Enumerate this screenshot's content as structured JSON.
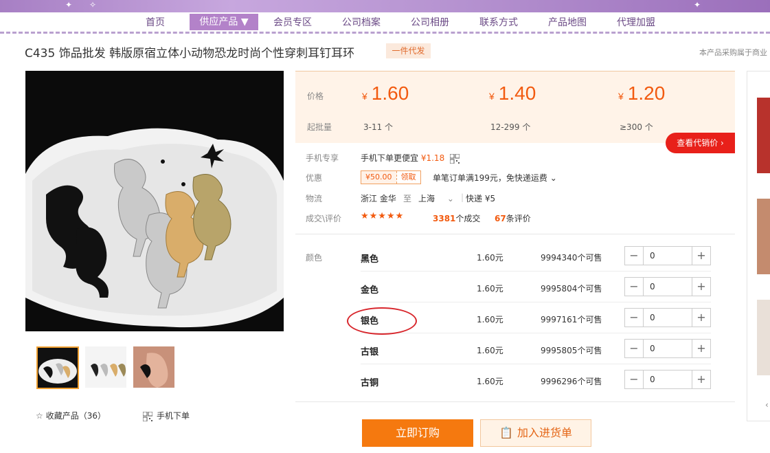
{
  "nav": {
    "items": [
      {
        "label": "首页",
        "active": false
      },
      {
        "label": "供应产品 ▼",
        "active": true
      },
      {
        "label": "会员专区",
        "active": false
      },
      {
        "label": "公司档案",
        "active": false
      },
      {
        "label": "公司相册",
        "active": false
      },
      {
        "label": "联系方式",
        "active": false
      },
      {
        "label": "产品地图",
        "active": false
      },
      {
        "label": "代理加盟",
        "active": false
      }
    ]
  },
  "product": {
    "title": "C435 饰品批发 韩版原宿立体小动物恐龙时尚个性穿刺耳钉耳环",
    "badge": "一件代发",
    "right_note": "本产品采购属于商业"
  },
  "gallery": {
    "thumbnails": [
      "thumb-black-dinosaurs",
      "thumb-colored-dinosaurs",
      "thumb-ear-model"
    ],
    "favorite_label": "收藏产品（36）",
    "mobile_label": "手机下单"
  },
  "pricing": {
    "price_label": "价格",
    "moq_label": "起批量",
    "tiers": [
      {
        "currency": "¥",
        "price": "1.60",
        "qty": "3-11 个"
      },
      {
        "currency": "¥",
        "price": "1.40",
        "qty": "12-299 个"
      },
      {
        "currency": "¥",
        "price": "1.20",
        "qty": "≥300 个"
      }
    ],
    "agent_button": "查看代销价 ›"
  },
  "info": {
    "mobile_label": "手机专享",
    "mobile_text": "手机下单更便宜",
    "mobile_price": "¥1.18",
    "discount_label": "优惠",
    "coupon_amount": "¥50.00",
    "coupon_get": "领取",
    "discount_text": "单笔订单满199元，免快递运费",
    "logistics_label": "物流",
    "from": "浙江 金华",
    "to_word": "至",
    "to": "上海",
    "shipping": "快递 ¥5",
    "deal_label": "成交\\评价",
    "stars": "★★★★★",
    "deals_count": "3381",
    "deals_text": "个成交",
    "reviews_count": "67",
    "reviews_text": "条评价"
  },
  "sku": {
    "label": "颜色",
    "rows": [
      {
        "name": "黑色",
        "price": "1.60元",
        "stock": "9994340个可售",
        "qty": "0"
      },
      {
        "name": "金色",
        "price": "1.60元",
        "stock": "9995804个可售",
        "qty": "0"
      },
      {
        "name": "银色",
        "price": "1.60元",
        "stock": "9997161个可售",
        "qty": "0"
      },
      {
        "name": "古银",
        "price": "1.60元",
        "stock": "9995805个可售",
        "qty": "0"
      },
      {
        "name": "古铜",
        "price": "1.60元",
        "stock": "9996296个可售",
        "qty": "0"
      }
    ]
  },
  "actions": {
    "buy": "立即订购",
    "cart": "加入进货单"
  },
  "colors": {
    "accent": "#f25a0f",
    "nav_active": "#b382c9",
    "agent_red": "#e8201a",
    "annotation": "#d8262c"
  }
}
